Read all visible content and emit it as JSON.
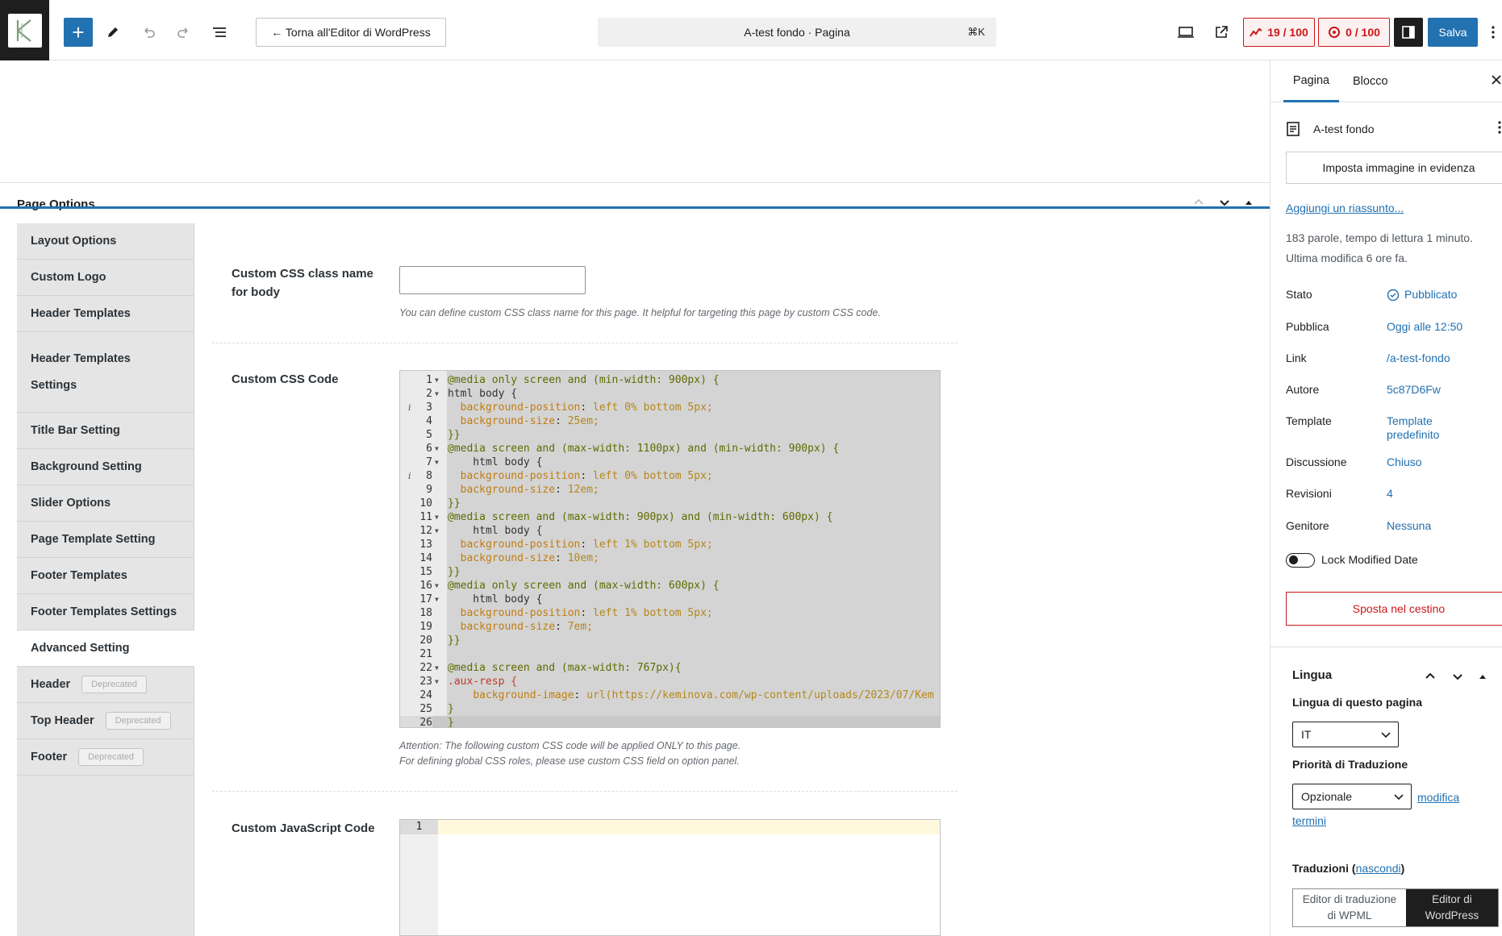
{
  "topbar": {
    "back_label": "← Torna all'Editor di WordPress",
    "doc_title": "A-test fondo · Pagina",
    "shortcut": "⌘K",
    "seo_score": "19 / 100",
    "readability_score": "0 / 100",
    "save_label": "Salva",
    "icons": [
      "add-block-icon",
      "pencil-icon",
      "undo-icon",
      "redo-icon",
      "list-view-icon",
      "desktop-view-icon",
      "external-link-icon",
      "sidebar-icon",
      "more-icon"
    ]
  },
  "page_options": {
    "title": "Page Options",
    "tabs": [
      {
        "label": "Layout Options"
      },
      {
        "label": "Custom Logo"
      },
      {
        "label": "Header Templates"
      },
      {
        "label": "Header Templates Settings"
      },
      {
        "label": "Title Bar Setting"
      },
      {
        "label": "Background Setting"
      },
      {
        "label": "Slider Options"
      },
      {
        "label": "Page Template Setting"
      },
      {
        "label": "Footer Templates"
      },
      {
        "label": "Footer Templates Settings"
      },
      {
        "label": "Advanced Setting"
      },
      {
        "label": "Header",
        "badge": "Deprecated"
      },
      {
        "label": "Top Header",
        "badge": "Deprecated"
      },
      {
        "label": "Footer",
        "badge": "Deprecated"
      }
    ],
    "active_tab": "Advanced Setting",
    "body_class": {
      "label": "Custom CSS class name for body",
      "value": "",
      "hint": "You can define custom CSS class name for this page. It helpful for targeting this page by custom CSS code."
    },
    "css": {
      "label": "Custom CSS Code",
      "lines": [
        "@media only screen and (min-width: 900px) {",
        "html body {",
        "  background-position: left 0% bottom 5px;",
        "  background-size: 25em;",
        "}}",
        "@media screen and (max-width: 1100px) and (min-width: 900px) {",
        "    html body {",
        "  background-position: left 0% bottom 5px;",
        "  background-size: 12em;",
        "}}",
        "@media screen and (max-width: 900px) and (min-width: 600px) {",
        "    html body {",
        "  background-position: left 1% bottom 5px;",
        "  background-size: 10em;",
        "}}",
        "@media only screen and (max-width: 600px) {",
        "    html body {",
        "  background-position: left 1% bottom 5px;",
        "  background-size: 7em;",
        "}}",
        "",
        "@media screen and (max-width: 767px){",
        ".aux-resp {",
        "    background-image: url(https://keminova.com/wp-content/uploads/2023/07/Kem",
        "}",
        "}"
      ],
      "hint_line1": "Attention: The following custom CSS code will be applied ONLY to this page.",
      "hint_line2": "For defining global CSS roles, please use custom CSS field on option panel."
    },
    "js": {
      "label": "Custom JavaScript Code",
      "line_number": "1"
    }
  },
  "sidebar": {
    "tab_page": "Pagina",
    "tab_block": "Blocco",
    "post_title": "A-test fondo",
    "featured_image": "Imposta immagine in evidenza",
    "add_excerpt": "Aggiungi un riassunto...",
    "stats_line1": "183 parole, tempo di lettura 1 minuto.",
    "stats_line2": "Ultima modifica 6 ore fa.",
    "rows": [
      {
        "label": "Stato",
        "value": "Pubblicato"
      },
      {
        "label": "Pubblica",
        "value": "Oggi alle 12:50"
      },
      {
        "label": "Link",
        "value": "/a-test-fondo"
      },
      {
        "label": "Autore",
        "value": "5c87D6Fw"
      },
      {
        "label": "Template",
        "value": "Template predefinito"
      },
      {
        "label": "Discussione",
        "value": "Chiuso"
      },
      {
        "label": "Revisioni",
        "value": "4"
      },
      {
        "label": "Genitore",
        "value": "Nessuna"
      }
    ],
    "lock_label": "Lock Modified Date",
    "trash_label": "Sposta nel cestino",
    "language": {
      "title": "Lingua",
      "page_lang_label": "Lingua di questo pagina",
      "page_lang_value": "IT",
      "priority_label": "Priorità di Traduzione",
      "priority_value": "Opzionale",
      "edit_terms_1": "modifica",
      "edit_terms_2": "termini",
      "translations_label": "Traduzioni (",
      "translations_hide": "nascondi",
      "translations_close": ")",
      "wpml_editor_1": "Editor di traduzione",
      "wpml_editor_2": "di WPML",
      "wp_editor_1": "Editor di",
      "wp_editor_2": "WordPress"
    }
  },
  "colors": {
    "accent": "#2271b1",
    "danger": "#cc1818"
  }
}
